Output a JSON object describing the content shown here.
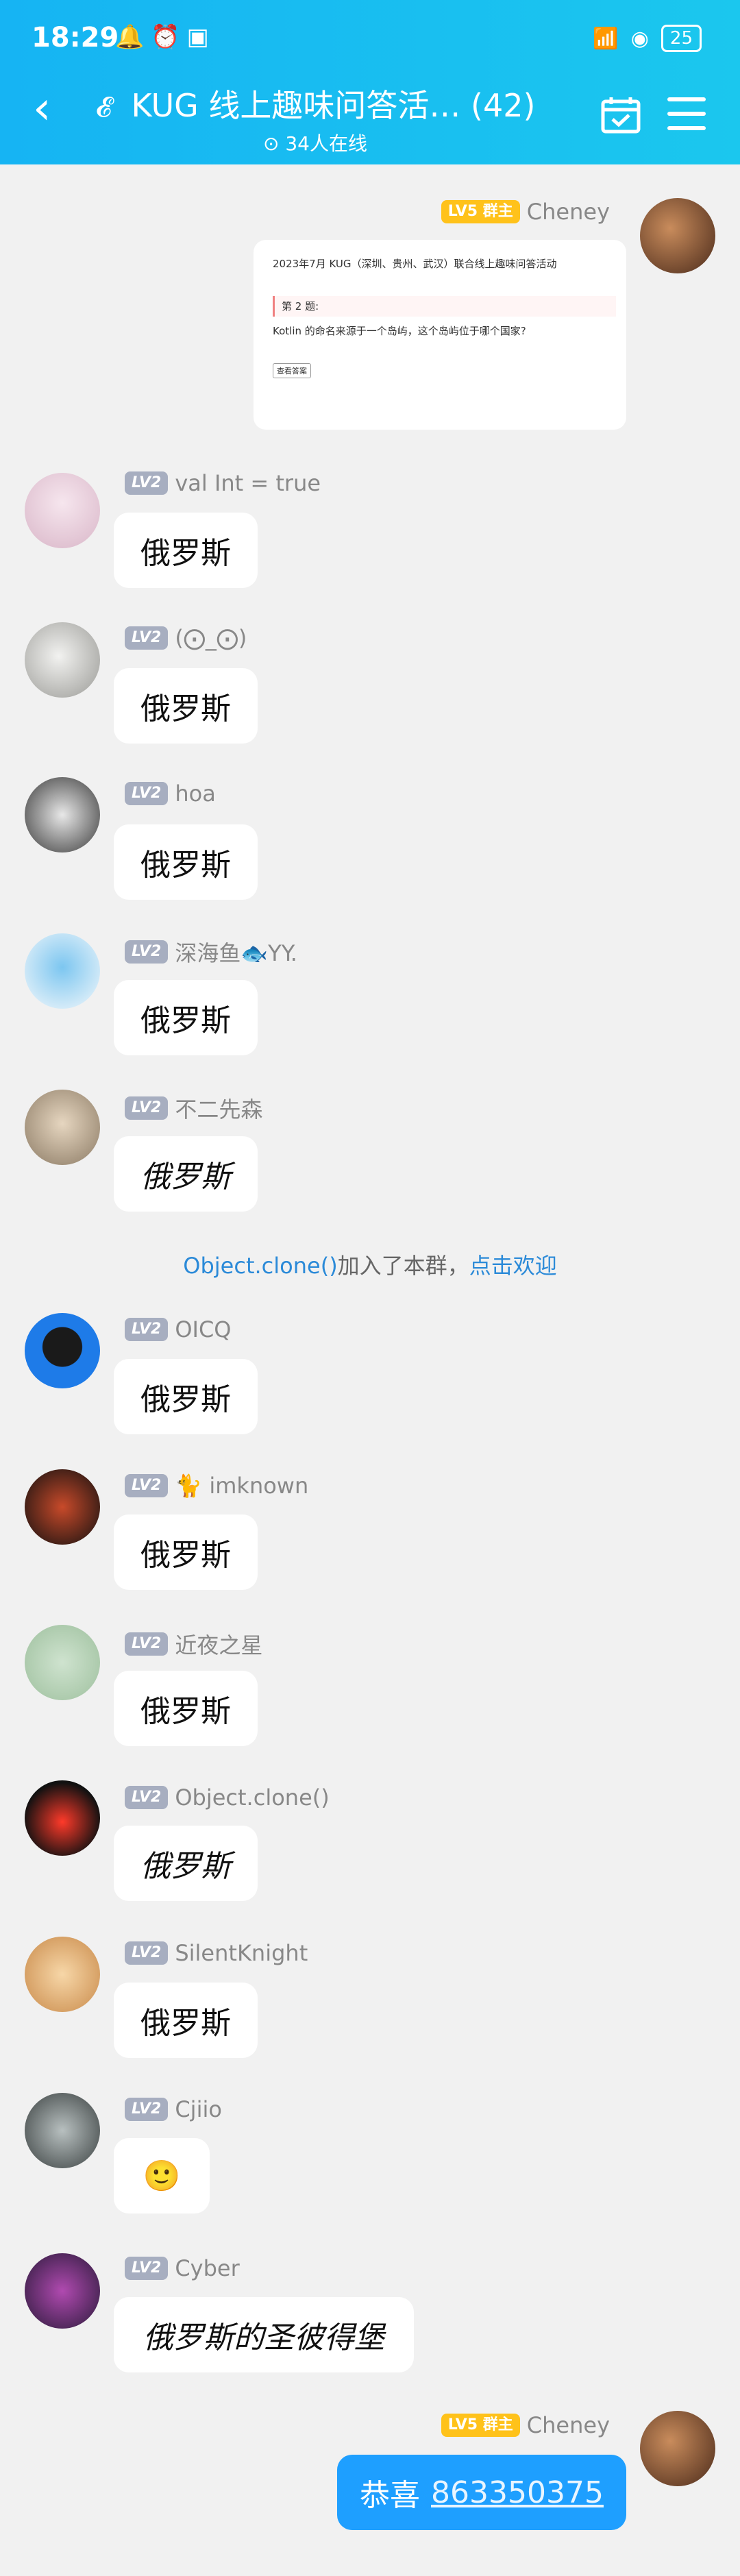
{
  "status_bar": {
    "time": "18:29",
    "battery": "25"
  },
  "header": {
    "title": "KUG 线上趣味问答活… (42)",
    "online_count": "34人在线"
  },
  "shared_card": {
    "title": "2023年7月 KUG（深圳、贵州、武汉）联合线上趣味问答活动",
    "question_label": "第 2 题:",
    "question_text": "Kotlin 的命名来源于一个岛屿，这个岛屿位于哪个国家?",
    "button_label": "查看答案"
  },
  "messages": [
    {
      "sender": "Cheney",
      "level": "LV5",
      "role": "群主",
      "text": ""
    },
    {
      "sender": "val Int  = true",
      "level": "LV2",
      "text": "俄罗斯"
    },
    {
      "sender": "(⨀_⨀)",
      "level": "LV2",
      "text": "俄罗斯"
    },
    {
      "sender": "hoa",
      "level": "LV2",
      "text": "俄罗斯"
    },
    {
      "sender": "深海鱼🐟YY.",
      "level": "LV2",
      "text": "俄罗斯"
    },
    {
      "sender": "不二先森",
      "level": "LV2",
      "text": "俄罗斯"
    },
    {
      "sender": "OICQ",
      "level": "LV2",
      "text": "俄罗斯"
    },
    {
      "sender": "🐈 imknown",
      "level": "LV2",
      "text": "俄罗斯"
    },
    {
      "sender": "近夜之星",
      "level": "LV2",
      "text": "俄罗斯"
    },
    {
      "sender": "Object.clone()",
      "level": "LV2",
      "text": "俄罗斯"
    },
    {
      "sender": "SilentKnight",
      "level": "LV2",
      "text": "俄罗斯"
    },
    {
      "sender": "Cjiio",
      "level": "LV2",
      "text": "🙂"
    },
    {
      "sender": "Cyber",
      "level": "LV2",
      "text": "俄罗斯的圣彼得堡"
    },
    {
      "sender": "Cheney",
      "level": "LV5",
      "role": "群主",
      "text": "恭喜",
      "link": "863350375"
    }
  ],
  "system_message": {
    "user": "Object.clone()",
    "text": "加入了本群，",
    "action": "点击欢迎"
  },
  "colors": {
    "header_start": "#16b4f3",
    "header_end": "#1bc7ee",
    "owner_badge": "#ffc21a",
    "member_badge": "#a7aec0",
    "self_bubble": "#1e9fff",
    "link": "#2b8ad8"
  }
}
